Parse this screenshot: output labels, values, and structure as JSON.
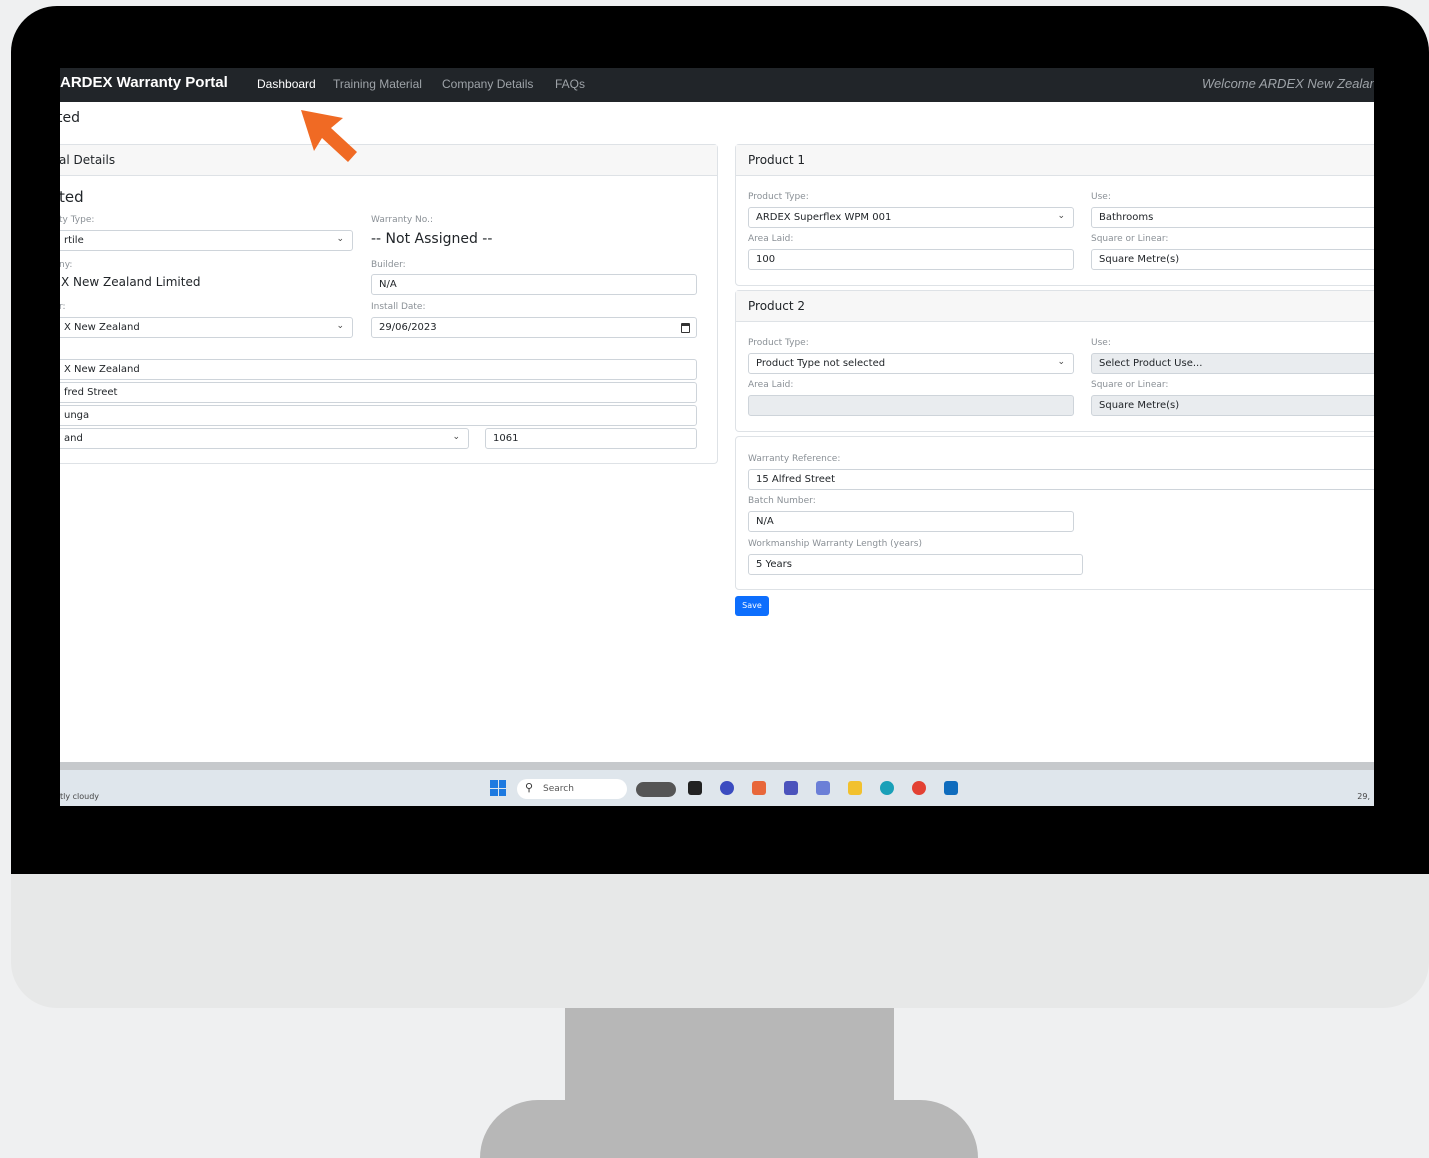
{
  "navbar": {
    "brand": "ARDEX Warranty Portal",
    "links": [
      "Dashboard",
      "Training Material",
      "Company Details",
      "FAQs"
    ],
    "active": "Dashboard",
    "welcome": "Welcome ARDEX New Zealand"
  },
  "page": {
    "title": "ted"
  },
  "general": {
    "header": "al Details",
    "heading": "ted",
    "warranty_type_label": "ty Type:",
    "warranty_type_value": "rtile",
    "warranty_no_label": "Warranty No.:",
    "warranty_no_value": "-- Not Assigned --",
    "company_label": "ny:",
    "company_value": "X New Zealand Limited",
    "builder_label": "Builder:",
    "builder_value": "N/A",
    "installer_label": "r:",
    "installer_value": "X New Zealand",
    "install_date_label": "Install Date:",
    "install_date_value": "29/06/2023",
    "address_name": "X New Zealand",
    "address_street": "fred Street",
    "address_suburb": "unga",
    "address_region": "and",
    "postcode": "1061"
  },
  "product1": {
    "header": "Product 1",
    "type_label": "Product Type:",
    "type_value": "ARDEX Superflex WPM 001",
    "use_label": "Use:",
    "use_value": "Bathrooms",
    "area_label": "Area Laid:",
    "area_value": "100",
    "unit_label": "Square or Linear:",
    "unit_value": "Square Metre(s)"
  },
  "product2": {
    "header": "Product 2",
    "type_label": "Product Type:",
    "type_value": "Product Type not selected",
    "use_label": "Use:",
    "use_value": "Select Product Use...",
    "area_label": "Area Laid:",
    "area_value": "",
    "unit_label": "Square or Linear:",
    "unit_value": "Square Metre(s)"
  },
  "warranty": {
    "reference_label": "Warranty Reference:",
    "reference_value": "15 Alfred Street",
    "batch_label": "Batch Number:",
    "batch_value": "N/A",
    "length_label": "Workmanship Warranty Length (years)",
    "length_value": "5 Years"
  },
  "save_label": "Save",
  "taskbar": {
    "weather": "tly cloudy",
    "search_placeholder": "Search",
    "clock": "29,"
  },
  "colors": {
    "navbar": "#212529",
    "primary_button": "#0d6efd",
    "pointer_arrow": "#f06a24"
  },
  "icons": [
    "chevron-down-icon",
    "calendar-icon",
    "windows-start-icon",
    "search-icon",
    "pointer-arrow-icon"
  ]
}
